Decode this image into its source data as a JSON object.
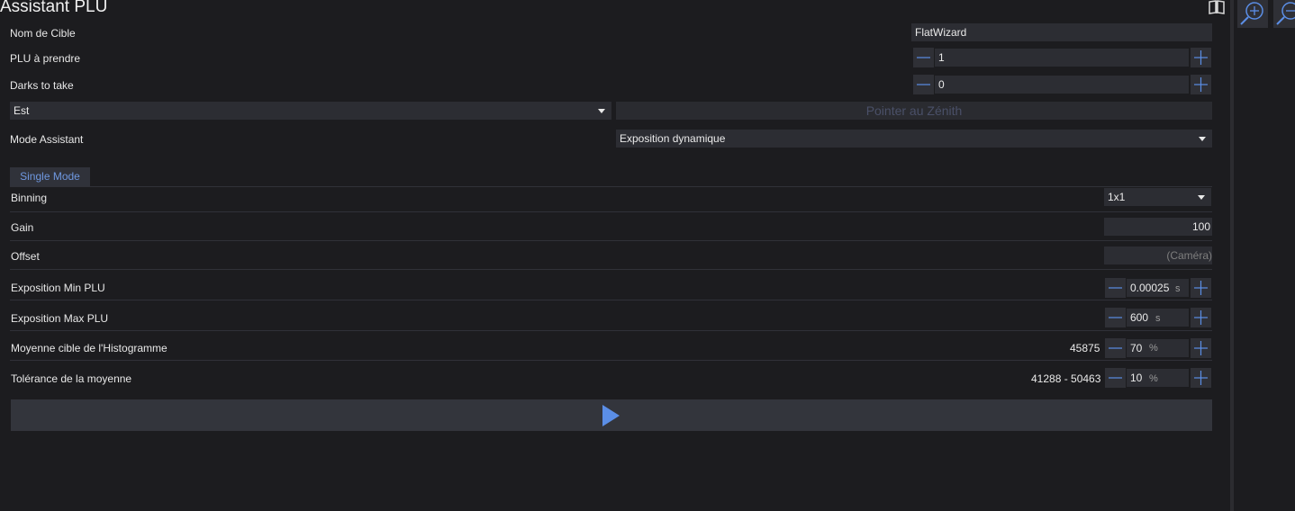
{
  "title": "Assistant PLU",
  "fields": {
    "target_name_label": "Nom de Cible",
    "target_name_value": "FlatWizard",
    "flats_label": "PLU à prendre",
    "flats_value": "1",
    "darks_label": "Darks to take",
    "darks_value": "0",
    "direction_value": "Est",
    "slew_zenith_label": "Pointer au Zénith",
    "mode_label": "Mode Assistant",
    "mode_value": "Exposition dynamique"
  },
  "tab": {
    "label": "Single Mode"
  },
  "settings": {
    "binning_label": "Binning",
    "binning_value": "1x1",
    "gain_label": "Gain",
    "gain_value": "100",
    "offset_label": "Offset",
    "offset_placeholder": "(Caméra)",
    "exp_min_label": "Exposition Min PLU",
    "exp_min_value": "0.00025",
    "exp_min_unit": "s",
    "exp_max_label": "Exposition Max PLU",
    "exp_max_value": "600",
    "exp_max_unit": "s",
    "hist_label": "Moyenne cible de l'Histogramme",
    "hist_adu": "45875",
    "hist_value": "70",
    "hist_unit": "%",
    "tol_label": "Tolérance de la moyenne",
    "tol_range": "41288 - 50463",
    "tol_value": "10",
    "tol_unit": "%"
  },
  "colors": {
    "background": "#1c1c1f",
    "field": "#2c2d33",
    "button": "#2f3036",
    "accent": "#5b8ee6"
  },
  "icons": [
    "book-icon",
    "zoom-in-icon",
    "zoom-out-icon",
    "minus-icon",
    "plus-icon",
    "chevron-down-icon",
    "play-icon"
  ]
}
